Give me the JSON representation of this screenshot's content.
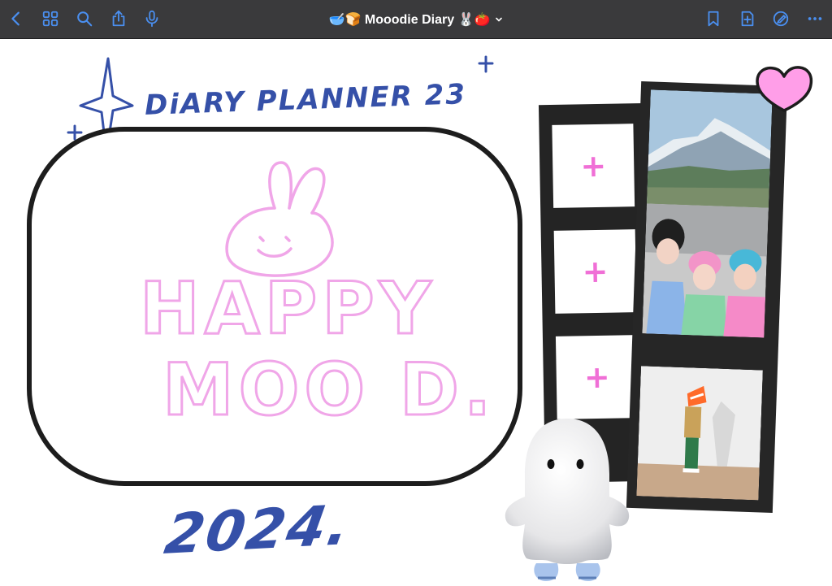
{
  "toolbar": {
    "title": "🥣🍞 Mooodie Diary 🐰🍅",
    "left_icons": [
      "back-chevron-icon",
      "grid-icon",
      "search-icon",
      "share-icon",
      "microphone-icon"
    ],
    "right_icons": [
      "bookmark-icon",
      "add-page-icon",
      "pencil-circle-icon",
      "more-icon"
    ],
    "icon_color": "#4a8ff0"
  },
  "canvas": {
    "heading": "DiARY PLANNER 23",
    "happy": "HAPPY",
    "mood": "MOO D.",
    "year": "2024.",
    "slot_symbol": "+",
    "colors": {
      "ink_blue": "#3550a8",
      "pink": "#f0a6e8",
      "film": "#242424",
      "heart": "#ff9ee8"
    }
  }
}
